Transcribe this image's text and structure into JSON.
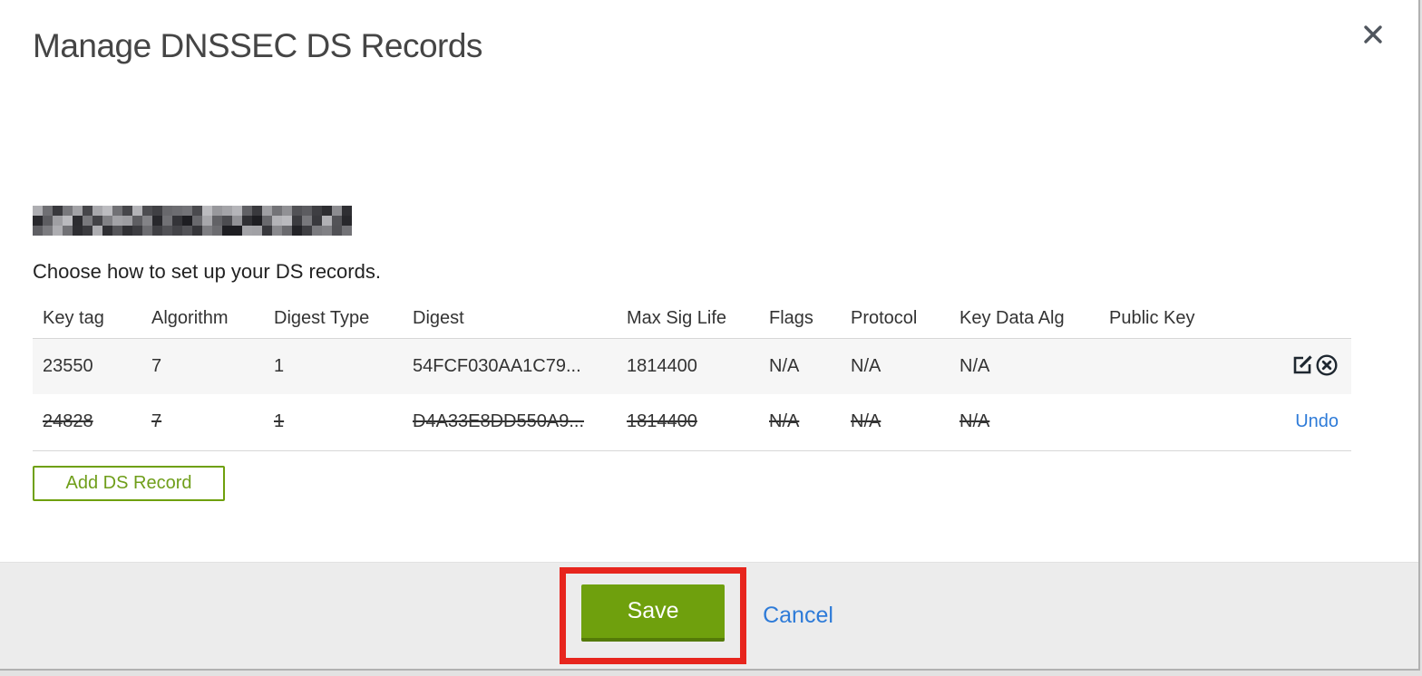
{
  "modal": {
    "title": "Manage DNSSEC DS Records"
  },
  "intro": {
    "domain_redacted": true,
    "instruction": "Choose how to set up your DS records."
  },
  "table": {
    "headers": [
      "Key tag",
      "Algorithm",
      "Digest Type",
      "Digest",
      "Max Sig Life",
      "Flags",
      "Protocol",
      "Key Data Alg",
      "Public Key"
    ],
    "rows": [
      {
        "key_tag": "23550",
        "algorithm": "7",
        "digest_type": "1",
        "digest": "54FCF030AA1C79...",
        "max_sig_life": "1814400",
        "flags": "N/A",
        "protocol": "N/A",
        "key_data_alg": "N/A",
        "public_key": "",
        "state": "normal",
        "actions": [
          "edit",
          "delete"
        ]
      },
      {
        "key_tag": "24828",
        "algorithm": "7",
        "digest_type": "1",
        "digest": "D4A33E8DD550A9...",
        "max_sig_life": "1814400",
        "flags": "N/A",
        "protocol": "N/A",
        "key_data_alg": "N/A",
        "public_key": "",
        "state": "deleted",
        "action_label": "Undo"
      }
    ]
  },
  "buttons": {
    "add_ds_record": "Add DS Record",
    "save": "Save",
    "cancel": "Cancel"
  },
  "icons": {
    "close": "close-icon",
    "edit": "edit-pencil-icon",
    "delete": "delete-circle-x-icon"
  },
  "colors": {
    "accent_green": "#6fa00d",
    "green_shadow": "#547a08",
    "link_blue": "#2e7bd8",
    "annotation_red": "#e7251d",
    "row_alt_bg": "#f6f6f6",
    "footer_bg": "#ececec"
  }
}
